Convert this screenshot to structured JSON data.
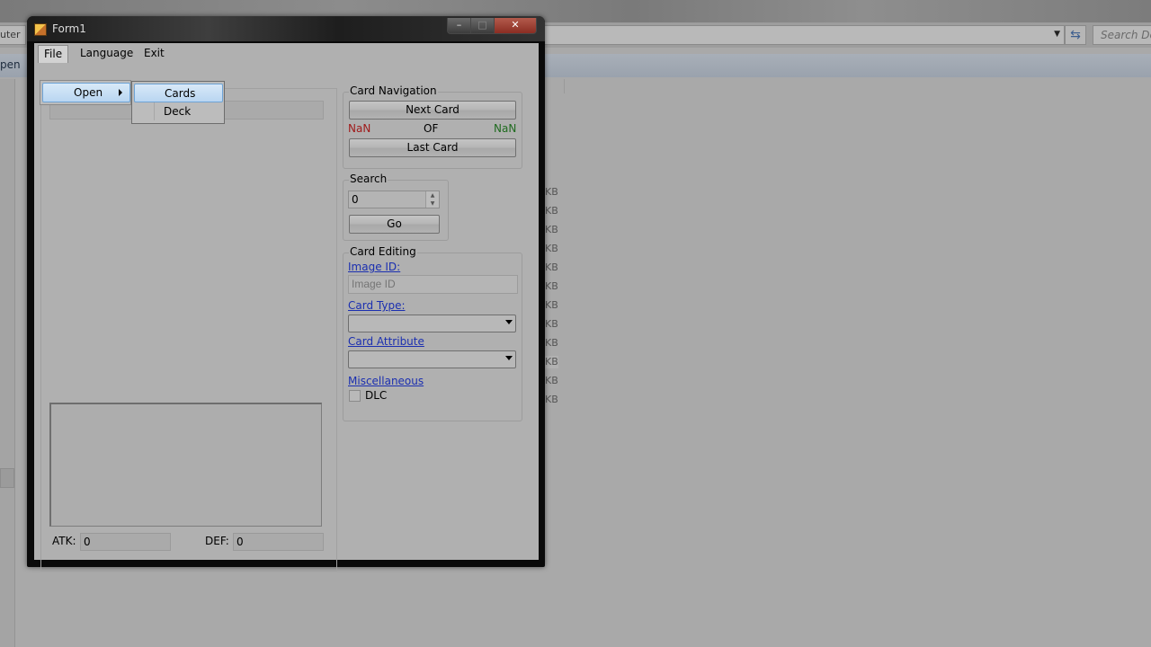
{
  "background": {
    "addr_left_text": "uter",
    "search_placeholder": "Search Deb",
    "cmd_left_text": "pen",
    "size_unit": "KB"
  },
  "window": {
    "title": "Form1",
    "controls": {
      "minimize": "–",
      "maximize": "□",
      "close": "✕"
    }
  },
  "menu": {
    "file": "File",
    "language": "Language",
    "exit": "Exit",
    "file_dropdown": {
      "open": "Open"
    },
    "open_submenu": {
      "cards": "Cards",
      "deck": "Deck"
    }
  },
  "card_navigation": {
    "title": "Card Navigation",
    "next_button": "Next Card",
    "current": "NaN",
    "of": "OF",
    "total": "NaN",
    "last_button": "Last Card"
  },
  "search": {
    "title": "Search",
    "value": "0",
    "go_button": "Go"
  },
  "card_editing": {
    "title": "Card Editing",
    "image_id_label": "Image ID:",
    "image_id_placeholder": "Image ID",
    "card_type_label": "Card Type:",
    "card_attribute_label": "Card Attribute",
    "misc_label": "Miscellaneous",
    "dlc_label": "DLC"
  },
  "stats": {
    "atk_label": "ATK:",
    "atk_value": "0",
    "def_label": "DEF:",
    "def_value": "0"
  }
}
